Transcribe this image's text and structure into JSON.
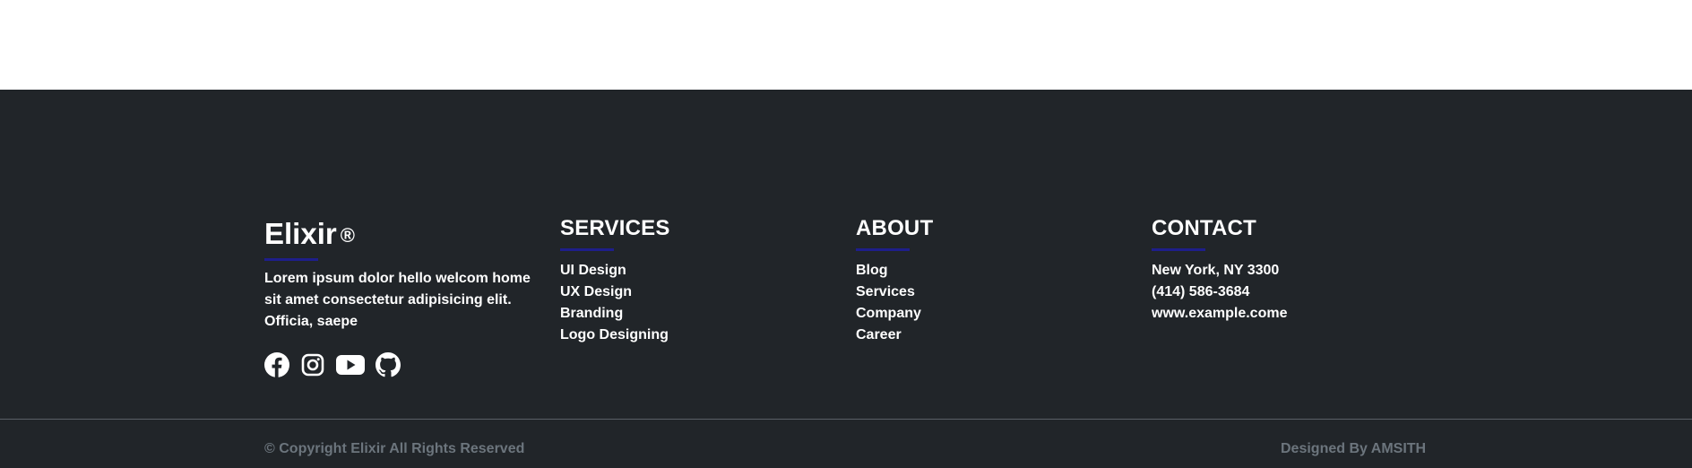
{
  "brand": {
    "name": "Elixir",
    "mark": "®",
    "description": "Lorem ipsum dolor hello welcom home sit amet consectetur adipisicing elit. Officia, saepe",
    "socials": [
      {
        "icon": "facebook-icon"
      },
      {
        "icon": "instagram-icon"
      },
      {
        "icon": "youtube-icon"
      },
      {
        "icon": "github-icon"
      }
    ]
  },
  "services": {
    "heading": "SERVICES",
    "items": [
      "UI Design",
      "UX Design",
      "Branding",
      "Logo Designing"
    ]
  },
  "about": {
    "heading": "ABOUT",
    "items": [
      "Blog",
      "Services",
      "Company",
      "Career"
    ]
  },
  "contact": {
    "heading": "CONTACT",
    "items": [
      "New York, NY 3300",
      "(414) 586-3684",
      "www.example.come"
    ]
  },
  "bottom": {
    "copyright": "© Copyright Elixir All Rights Reserved",
    "designed_by": "Designed By AMSITH"
  },
  "colors": {
    "footer_bg": "#212529",
    "accent_underline": "#1e1e8a",
    "muted_text": "#6c757d"
  }
}
